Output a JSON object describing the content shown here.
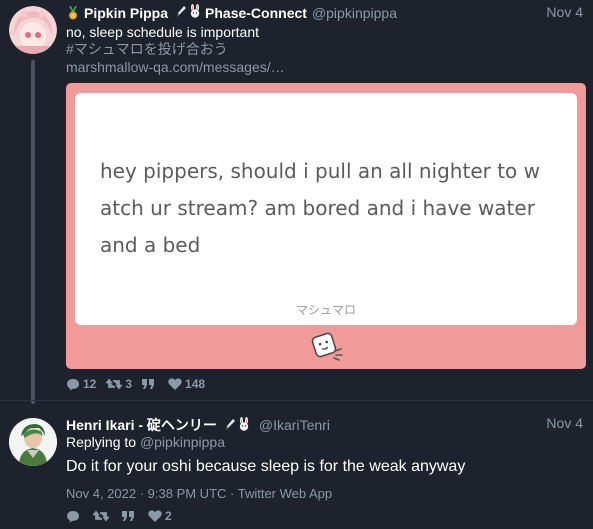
{
  "tweet1": {
    "name": "Pipkin Pippa",
    "affiliation": "Phase-Connect",
    "handle": "@pipkinpippa",
    "date": "Nov 4",
    "text": "no, sleep schedule is important",
    "hashtag": "#マシュマロを投げ合おう",
    "link": "marshmallow-qa.com/messages/…",
    "card": {
      "question": "hey pippers, should i pull an all nighter to watch ur stream? am bored and i have water and a bed",
      "footer": "マシュマロ"
    },
    "stats": {
      "replies": "12",
      "retweets": "3",
      "quotes": "",
      "likes": "148"
    }
  },
  "tweet2": {
    "name": "Henri Ikari - 碇ヘンリー",
    "handle": "@IkariTenri",
    "date": "Nov 4",
    "replying_prefix": "Replying to",
    "replying_to": "@pipkinpippa",
    "text": "Do it for your oshi because sleep is for the weak anyway",
    "timestamp": "Nov 4, 2022 · 9:38 PM UTC · Twitter Web App",
    "stats": {
      "replies": "",
      "retweets": "",
      "quotes": "",
      "likes": "2"
    }
  },
  "icons": [
    "medal-icon",
    "pen-icon",
    "rabbit-icon",
    "reply-icon",
    "retweet-icon",
    "quote-icon",
    "heart-icon",
    "marshmallow-icon"
  ],
  "colors": {
    "background": "#1e222c",
    "card": "#f09a9a",
    "muted": "#8b98a5"
  }
}
